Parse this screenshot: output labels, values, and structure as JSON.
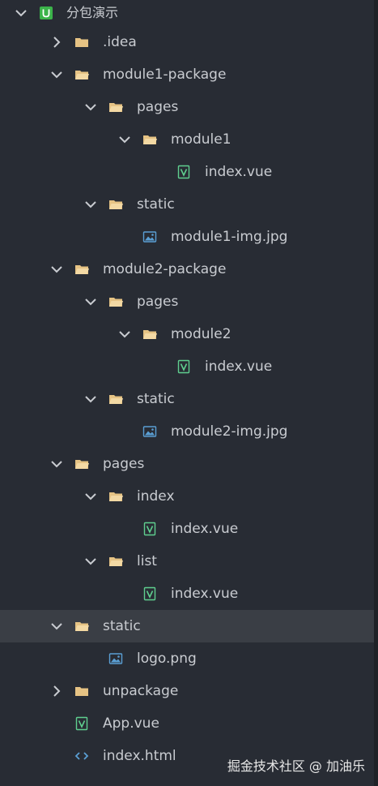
{
  "project": {
    "root_label": "分包演示"
  },
  "tree": [
    {
      "label": "分包演示",
      "depth": 0,
      "type": "project",
      "expanded": true,
      "name": "project-root"
    },
    {
      "label": ".idea",
      "depth": 1,
      "type": "folder",
      "expanded": false,
      "name": "folder-idea"
    },
    {
      "label": "module1-package",
      "depth": 1,
      "type": "folder",
      "expanded": true,
      "name": "folder-module1-package"
    },
    {
      "label": "pages",
      "depth": 2,
      "type": "folder",
      "expanded": true,
      "name": "folder-module1-pages"
    },
    {
      "label": "module1",
      "depth": 3,
      "type": "folder",
      "expanded": true,
      "name": "folder-module1"
    },
    {
      "label": "index.vue",
      "depth": 4,
      "type": "vue",
      "name": "file-module1-index-vue"
    },
    {
      "label": "static",
      "depth": 2,
      "type": "folder",
      "expanded": true,
      "name": "folder-module1-static"
    },
    {
      "label": "module1-img.jpg",
      "depth": 3,
      "type": "image",
      "name": "file-module1-img"
    },
    {
      "label": "module2-package",
      "depth": 1,
      "type": "folder",
      "expanded": true,
      "name": "folder-module2-package"
    },
    {
      "label": "pages",
      "depth": 2,
      "type": "folder",
      "expanded": true,
      "name": "folder-module2-pages"
    },
    {
      "label": "module2",
      "depth": 3,
      "type": "folder",
      "expanded": true,
      "name": "folder-module2"
    },
    {
      "label": "index.vue",
      "depth": 4,
      "type": "vue",
      "name": "file-module2-index-vue"
    },
    {
      "label": "static",
      "depth": 2,
      "type": "folder",
      "expanded": true,
      "name": "folder-module2-static"
    },
    {
      "label": "module2-img.jpg",
      "depth": 3,
      "type": "image",
      "name": "file-module2-img"
    },
    {
      "label": "pages",
      "depth": 1,
      "type": "folder",
      "expanded": true,
      "name": "folder-pages"
    },
    {
      "label": "index",
      "depth": 2,
      "type": "folder",
      "expanded": true,
      "name": "folder-pages-index"
    },
    {
      "label": "index.vue",
      "depth": 3,
      "type": "vue",
      "name": "file-pages-index-vue"
    },
    {
      "label": "list",
      "depth": 2,
      "type": "folder",
      "expanded": true,
      "name": "folder-pages-list"
    },
    {
      "label": "index.vue",
      "depth": 3,
      "type": "vue",
      "name": "file-pages-list-index-vue"
    },
    {
      "label": "static",
      "depth": 1,
      "type": "folder",
      "expanded": true,
      "selected": true,
      "name": "folder-static"
    },
    {
      "label": "logo.png",
      "depth": 2,
      "type": "image",
      "name": "file-logo-png"
    },
    {
      "label": "unpackage",
      "depth": 1,
      "type": "folder",
      "expanded": false,
      "name": "folder-unpackage"
    },
    {
      "label": "App.vue",
      "depth": 1,
      "type": "vue",
      "name": "file-app-vue"
    },
    {
      "label": "index.html",
      "depth": 1,
      "type": "html",
      "name": "file-index-html"
    },
    {
      "label": "",
      "depth": 1,
      "type": "partial",
      "name": "file-partial"
    }
  ],
  "icons": {
    "project": "uniapp-project-icon",
    "folder": "folder-icon",
    "vue": "vue-file-icon",
    "image": "image-file-icon",
    "html": "html-file-icon",
    "chevron_open": "chevron-down-icon",
    "chevron_closed": "chevron-right-icon"
  },
  "colors": {
    "background": "#282c34",
    "selected_row": "#3a3e45",
    "text": "#c9ccd1",
    "folder": "#e6c384",
    "vue": "#5fcf8f",
    "image": "#5a9fd4",
    "html": "#5a9fd4",
    "project_badge": "#3bb34a"
  },
  "watermark": "掘金技术社区 @ 加油乐"
}
